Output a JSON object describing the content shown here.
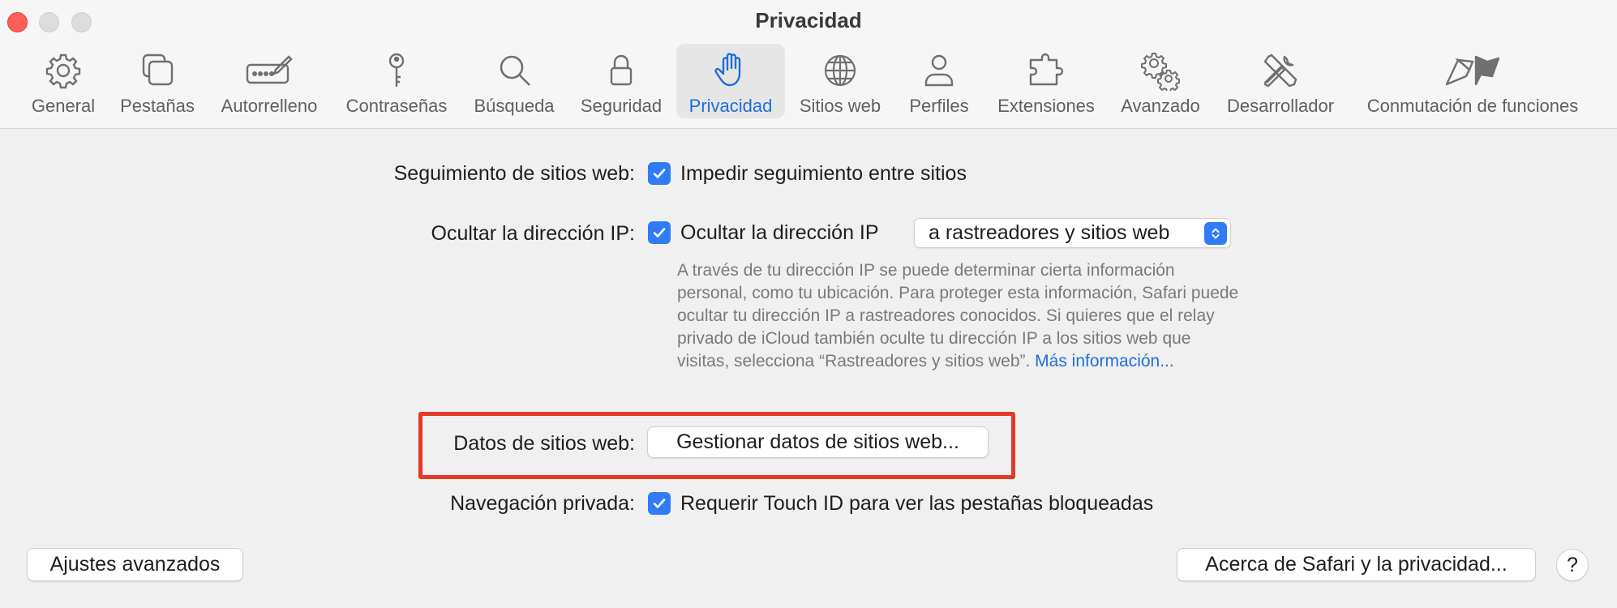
{
  "window": {
    "title": "Privacidad"
  },
  "tabs": [
    {
      "label": "General",
      "icon": "gear-icon"
    },
    {
      "label": "Pestañas",
      "icon": "tabs-icon"
    },
    {
      "label": "Autorrelleno",
      "icon": "autofill-icon"
    },
    {
      "label": "Contraseñas",
      "icon": "key-icon"
    },
    {
      "label": "Búsqueda",
      "icon": "search-icon"
    },
    {
      "label": "Seguridad",
      "icon": "lock-icon"
    },
    {
      "label": "Privacidad",
      "icon": "hand-icon",
      "active": true
    },
    {
      "label": "Sitios web",
      "icon": "globe-icon"
    },
    {
      "label": "Perfiles",
      "icon": "person-icon"
    },
    {
      "label": "Extensiones",
      "icon": "puzzle-icon"
    },
    {
      "label": "Avanzado",
      "icon": "gears-icon"
    },
    {
      "label": "Desarrollador",
      "icon": "tools-icon"
    },
    {
      "label": "Conmutación de funciones",
      "icon": "flags-icon"
    }
  ],
  "settings": {
    "tracking": {
      "label": "Seguimiento de sitios web:",
      "checkbox_text": "Impedir seguimiento entre sitios",
      "checked": true
    },
    "hide_ip": {
      "label": "Ocultar la dirección IP:",
      "checkbox_text": "Ocultar la dirección IP",
      "checked": true,
      "select_value": "a rastreadores y sitios web",
      "description": "A través de tu dirección IP se puede determinar cierta información personal, como tu ubicación. Para proteger esta información, Safari puede ocultar tu dirección IP a rastreadores conocidos. Si quieres que el relay privado de iCloud también oculte tu dirección IP a los sitios web que visitas, selecciona “Rastreadores y sitios web”. ",
      "link": "Más información..."
    },
    "website_data": {
      "label": "Datos de sitios web:",
      "button": "Gestionar datos de sitios web..."
    },
    "private_browsing": {
      "label": "Navegación privada:",
      "checkbox_text": "Requerir Touch ID para ver las pestañas bloqueadas",
      "checked": true
    }
  },
  "footer": {
    "advanced_button": "Ajustes avanzados",
    "about_button": "Acerca de Safari y la privacidad...",
    "help_button": "?"
  },
  "colors": {
    "accent": "#2f7cf6",
    "active_tab_text": "#1e6fdb",
    "highlight": "#e33a26",
    "close": "#fe5f57"
  }
}
